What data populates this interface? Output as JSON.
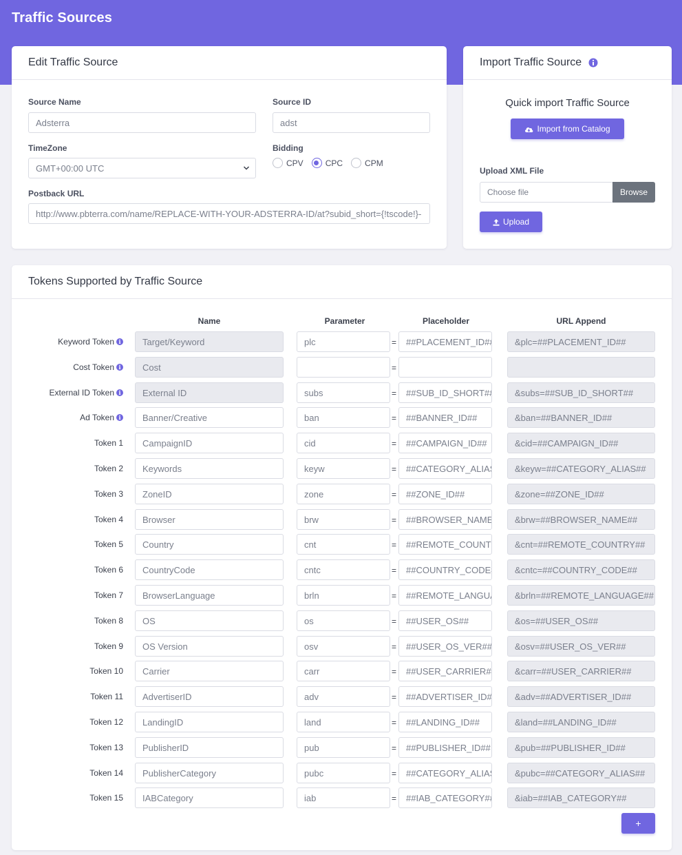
{
  "page": {
    "title": "Traffic Sources"
  },
  "colors": {
    "accent": "#7066e0",
    "browse_bg": "#6c737d",
    "readonly_bg": "#e9eaef"
  },
  "edit_card": {
    "title": "Edit Traffic Source",
    "source_name_label": "Source Name",
    "source_name_value": "Adsterra",
    "source_id_label": "Source ID",
    "source_id_value": "adst",
    "timezone_label": "TimeZone",
    "timezone_value": "GMT+00:00 UTC",
    "bidding_label": "Bidding",
    "bidding_options": [
      "CPV",
      "CPC",
      "CPM"
    ],
    "bidding_selected": "CPC",
    "postback_label": "Postback URL",
    "postback_value": "http://www.pbterra.com/name/REPLACE-WITH-YOUR-ADSTERRA-ID/at?subid_short={!tscode!}-"
  },
  "import_card": {
    "title": "Import Traffic Source",
    "info_icon": "info-circle-icon",
    "quick_import_text": "Quick import Traffic Source",
    "import_button": "Import from Catalog",
    "import_icon": "cloud-download-icon",
    "upload_label": "Upload XML File",
    "file_placeholder": "Choose file",
    "browse_label": "Browse",
    "upload_button": "Upload",
    "upload_icon": "upload-icon"
  },
  "tokens_card": {
    "title": "Tokens Supported by Traffic Source",
    "columns": {
      "name": "Name",
      "parameter": "Parameter",
      "placeholder": "Placeholder",
      "url_append": "URL Append"
    },
    "eq_sign": "=",
    "add_button": "+",
    "rows": [
      {
        "label": "Keyword Token",
        "info": true,
        "name": "Target/Keyword",
        "name_ro": true,
        "param": "plc",
        "placeholder": "##PLACEMENT_ID##",
        "append": "&plc=##PLACEMENT_ID##"
      },
      {
        "label": "Cost Token",
        "info": true,
        "name": "Cost",
        "name_ro": true,
        "param": "",
        "placeholder": "",
        "append": ""
      },
      {
        "label": "External ID Token",
        "info": true,
        "name": "External ID",
        "name_ro": true,
        "param": "subs",
        "placeholder": "##SUB_ID_SHORT##",
        "append": "&subs=##SUB_ID_SHORT##"
      },
      {
        "label": "Ad Token",
        "info": true,
        "name": "Banner/Creative",
        "name_ro": false,
        "param": "ban",
        "placeholder": "##BANNER_ID##",
        "append": "&ban=##BANNER_ID##"
      },
      {
        "label": "Token 1",
        "info": false,
        "name": "CampaignID",
        "name_ro": false,
        "param": "cid",
        "placeholder": "##CAMPAIGN_ID##",
        "append": "&cid=##CAMPAIGN_ID##"
      },
      {
        "label": "Token 2",
        "info": false,
        "name": "Keywords",
        "name_ro": false,
        "param": "keyw",
        "placeholder": "##CATEGORY_ALIAS##",
        "append": "&keyw=##CATEGORY_ALIAS##"
      },
      {
        "label": "Token 3",
        "info": false,
        "name": "ZoneID",
        "name_ro": false,
        "param": "zone",
        "placeholder": "##ZONE_ID##",
        "append": "&zone=##ZONE_ID##"
      },
      {
        "label": "Token 4",
        "info": false,
        "name": "Browser",
        "name_ro": false,
        "param": "brw",
        "placeholder": "##BROWSER_NAME##",
        "append": "&brw=##BROWSER_NAME##"
      },
      {
        "label": "Token 5",
        "info": false,
        "name": "Country",
        "name_ro": false,
        "param": "cnt",
        "placeholder": "##REMOTE_COUNTRY##",
        "append": "&cnt=##REMOTE_COUNTRY##"
      },
      {
        "label": "Token 6",
        "info": false,
        "name": "CountryCode",
        "name_ro": false,
        "param": "cntc",
        "placeholder": "##COUNTRY_CODE##",
        "append": "&cntc=##COUNTRY_CODE##"
      },
      {
        "label": "Token 7",
        "info": false,
        "name": "BrowserLanguage",
        "name_ro": false,
        "param": "brln",
        "placeholder": "##REMOTE_LANGUAGE##",
        "append": "&brln=##REMOTE_LANGUAGE##"
      },
      {
        "label": "Token 8",
        "info": false,
        "name": "OS",
        "name_ro": false,
        "param": "os",
        "placeholder": "##USER_OS##",
        "append": "&os=##USER_OS##"
      },
      {
        "label": "Token 9",
        "info": false,
        "name": "OS Version",
        "name_ro": false,
        "param": "osv",
        "placeholder": "##USER_OS_VER##",
        "append": "&osv=##USER_OS_VER##"
      },
      {
        "label": "Token 10",
        "info": false,
        "name": "Carrier",
        "name_ro": false,
        "param": "carr",
        "placeholder": "##USER_CARRIER##",
        "append": "&carr=##USER_CARRIER##"
      },
      {
        "label": "Token 11",
        "info": false,
        "name": "AdvertiserID",
        "name_ro": false,
        "param": "adv",
        "placeholder": "##ADVERTISER_ID##",
        "append": "&adv=##ADVERTISER_ID##"
      },
      {
        "label": "Token 12",
        "info": false,
        "name": "LandingID",
        "name_ro": false,
        "param": "land",
        "placeholder": "##LANDING_ID##",
        "append": "&land=##LANDING_ID##"
      },
      {
        "label": "Token 13",
        "info": false,
        "name": "PublisherID",
        "name_ro": false,
        "param": "pub",
        "placeholder": "##PUBLISHER_ID##",
        "append": "&pub=##PUBLISHER_ID##"
      },
      {
        "label": "Token 14",
        "info": false,
        "name": "PublisherCategory",
        "name_ro": false,
        "param": "pubc",
        "placeholder": "##CATEGORY_ALIAS##",
        "append": "&pubc=##CATEGORY_ALIAS##"
      },
      {
        "label": "Token 15",
        "info": false,
        "name": "IABCategory",
        "name_ro": false,
        "param": "iab",
        "placeholder": "##IAB_CATEGORY##",
        "append": "&iab=##IAB_CATEGORY##"
      }
    ]
  }
}
